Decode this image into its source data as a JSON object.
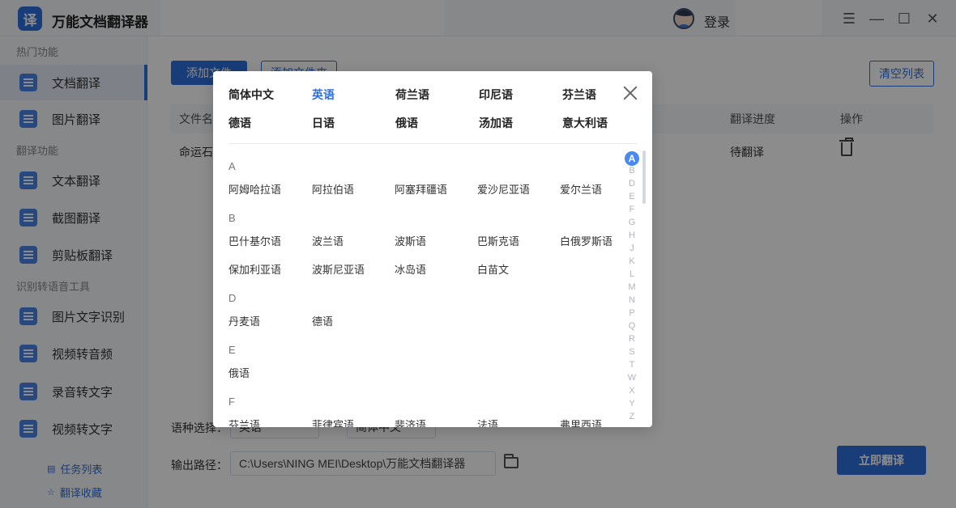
{
  "app": {
    "logo_glyph": "译",
    "title": "万能文档翻译器",
    "login_label": "登录",
    "window_controls": {
      "menu": "☰",
      "minimize": "—",
      "maximize": "☐",
      "close": "✕"
    }
  },
  "sidebar": {
    "section_hot": "热门功能",
    "section_translate": "翻译功能",
    "section_tools": "识别转语音工具",
    "items": [
      {
        "label": "文档翻译",
        "icon": "document-icon"
      },
      {
        "label": "图片翻译",
        "icon": "image-icon"
      },
      {
        "label": "文本翻译",
        "icon": "text-icon"
      },
      {
        "label": "截图翻译",
        "icon": "screenshot-icon"
      },
      {
        "label": "剪贴板翻译",
        "icon": "clipboard-icon"
      },
      {
        "label": "图片文字识别",
        "icon": "ocr-icon"
      },
      {
        "label": "视频转音频",
        "icon": "video-audio-icon"
      },
      {
        "label": "录音转文字",
        "icon": "recording-icon"
      },
      {
        "label": "视频转文字",
        "icon": "video-text-icon"
      }
    ],
    "footer": {
      "tasks": "任务列表",
      "favorites": "翻译收藏"
    }
  },
  "main": {
    "add_file": "添加文件",
    "add_folder": "添加文件夹",
    "clear_list": "清空列表",
    "table": {
      "headers": {
        "filename": "文件名",
        "progress": "翻译进度",
        "action": "操作"
      },
      "rows": [
        {
          "filename": "命运石之",
          "status": "待翻译"
        }
      ]
    },
    "lang_label": "语种选择：",
    "source_lang": "英语",
    "target_lang": "简体中文",
    "output_label": "输出路径：",
    "output_path": "C:\\Users\\NING MEI\\Desktop\\万能文档翻译器",
    "translate_btn": "立即翻译"
  },
  "modal": {
    "common_languages": [
      [
        "简体中文",
        "英语",
        "荷兰语",
        "印尼语",
        "芬兰语"
      ],
      [
        "德语",
        "日语",
        "俄语",
        "汤加语",
        "意大利语"
      ]
    ],
    "selected_common": "英语",
    "groups": [
      {
        "letter": "A",
        "languages": [
          "阿姆哈拉语",
          "阿拉伯语",
          "阿塞拜疆语",
          "爱沙尼亚语",
          "爱尔兰语"
        ]
      },
      {
        "letter": "B",
        "languages": [
          "巴什基尔语",
          "波兰语",
          "波斯语",
          "巴斯克语",
          "白俄罗斯语",
          "保加利亚语",
          "波斯尼亚语",
          "冰岛语",
          "白苗文"
        ]
      },
      {
        "letter": "D",
        "languages": [
          "丹麦语",
          "德语"
        ]
      },
      {
        "letter": "E",
        "languages": [
          "俄语"
        ]
      },
      {
        "letter": "F",
        "languages": [
          "芬兰语",
          "菲律宾语",
          "斐济语",
          "法语",
          "弗里西语"
        ]
      }
    ],
    "alphabet": [
      "A",
      "B",
      "D",
      "E",
      "F",
      "G",
      "H",
      "J",
      "K",
      "L",
      "M",
      "N",
      "P",
      "Q",
      "R",
      "S",
      "T",
      "W",
      "X",
      "Y",
      "Z"
    ],
    "active_letter": "A"
  }
}
